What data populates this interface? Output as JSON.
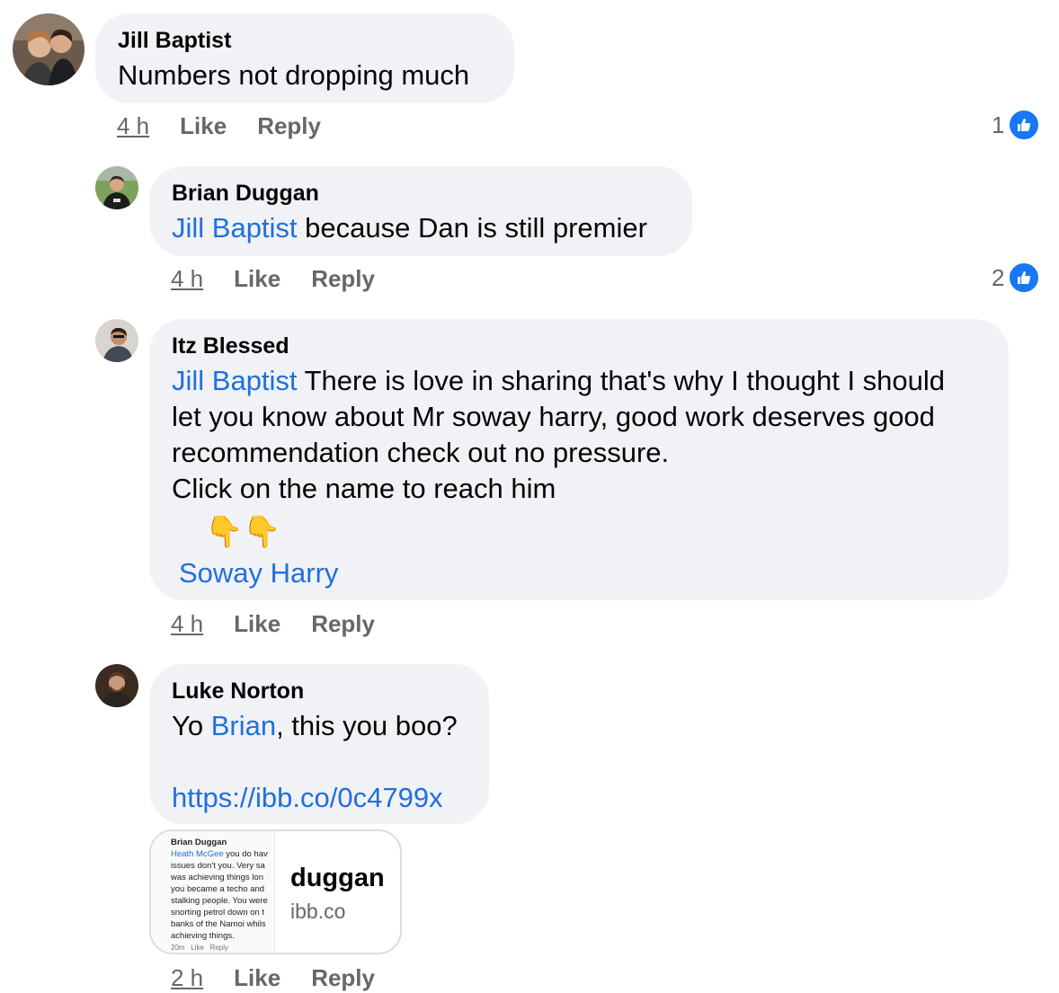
{
  "comments": [
    {
      "author": "Jill Baptist",
      "text": "Numbers not dropping much",
      "time": "4 h",
      "like_label": "Like",
      "reply_label": "Reply",
      "reactions": "1"
    },
    {
      "author": "Brian Duggan",
      "mention": "Jill Baptist",
      "text": " because Dan is still premier",
      "time": "4 h",
      "like_label": "Like",
      "reply_label": "Reply",
      "reactions": "2"
    },
    {
      "author": "Itz Blessed",
      "mention": "Jill Baptist",
      "line1": " There is love in sharing that's why I thought I should",
      "line2": "let you know about Mr soway harry, good work deserves good",
      "line3": "recommendation check out no pressure.",
      "line4": "Click on the name to reach him",
      "emoji": "👇👇",
      "name_link": "Soway Harry",
      "time": "4 h",
      "like_label": "Like",
      "reply_label": "Reply"
    },
    {
      "author": "Luke Norton",
      "text_before": "Yo ",
      "mention": "Brian",
      "text_after": ", this you boo?",
      "url": "https://ibb.co/0c4799x",
      "preview": {
        "title": "duggan",
        "domain": "ibb.co",
        "thumb_name": "Brian Duggan",
        "thumb_mention": "Heath McGee",
        "thumb_lines": [
          " you do hav",
          "issues don't you. Very sa",
          "was achieving things lon",
          "you became a techo and",
          "stalking people. You were",
          "snorting petrol down on t",
          "banks of the Namoi whils",
          "achieving things."
        ],
        "thumb_meta": "20m   Like   Reply"
      },
      "time": "2 h",
      "like_label": "Like",
      "reply_label": "Reply"
    }
  ],
  "colors": {
    "link": "#216fdb",
    "bubble": "#f0f2f5",
    "like": "#1877f2"
  }
}
